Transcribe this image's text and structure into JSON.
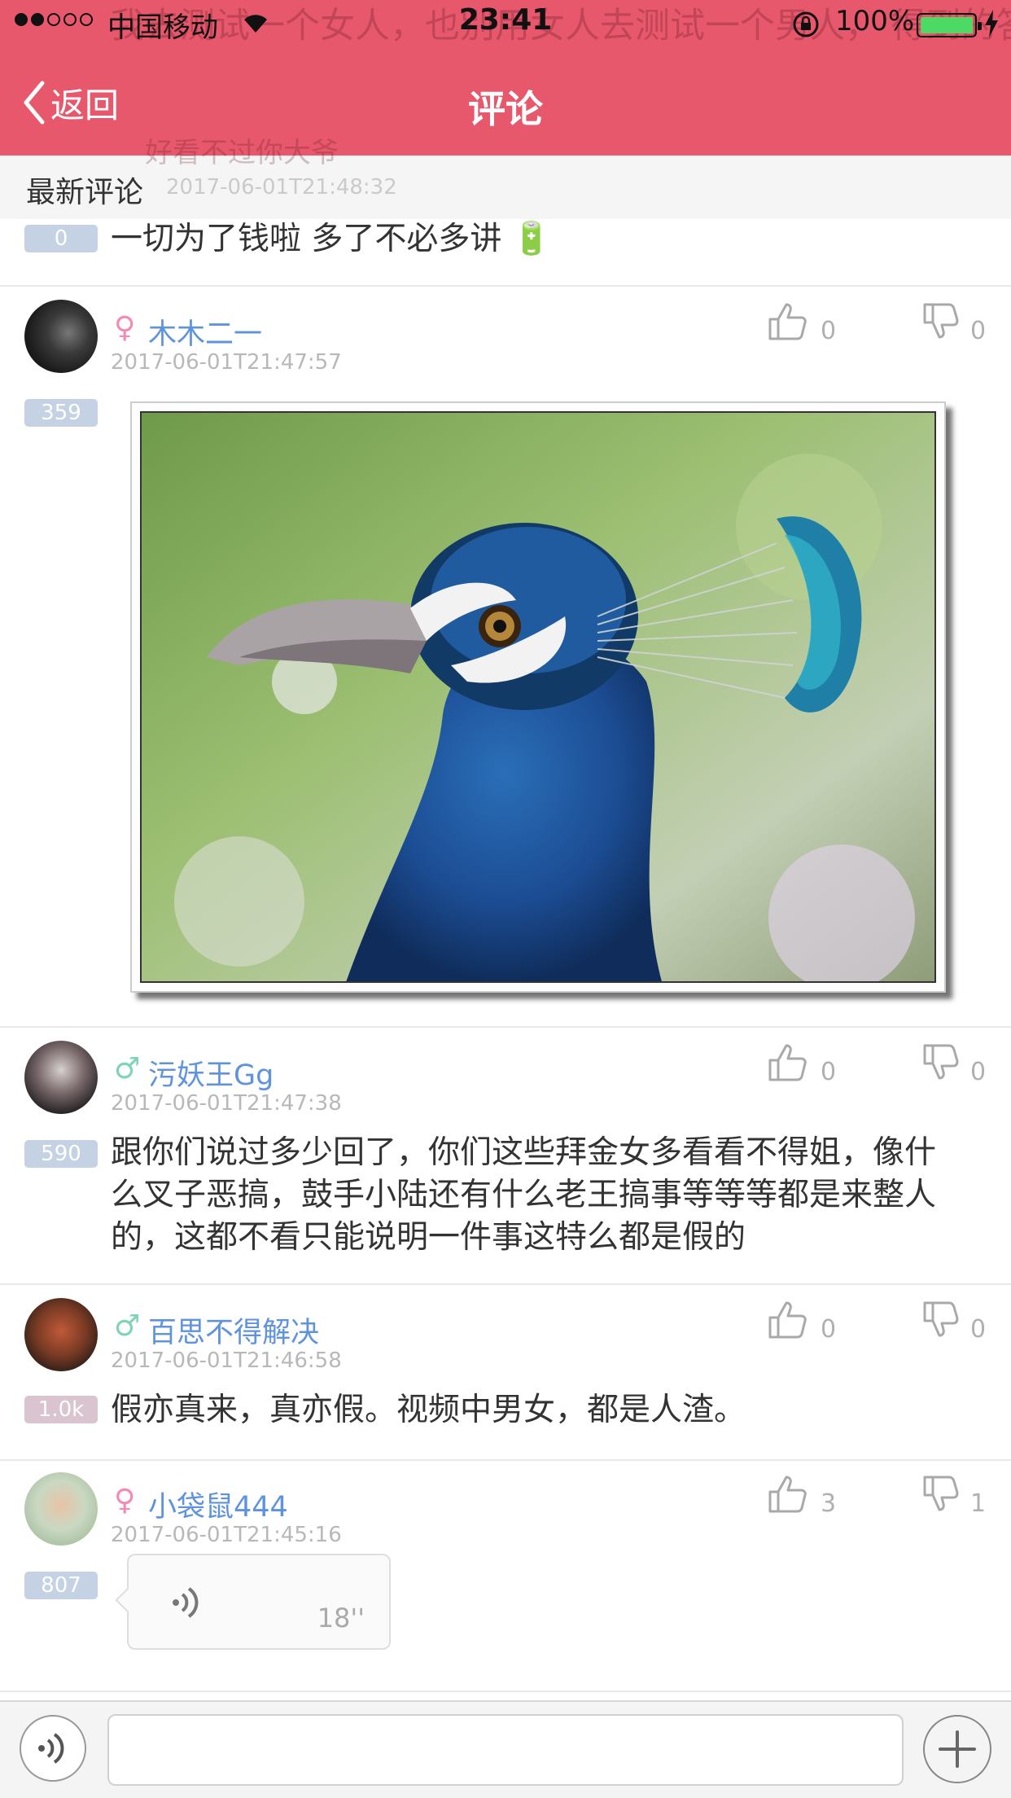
{
  "status_bar": {
    "carrier": "中国移动",
    "time": "23:41",
    "battery": "100%"
  },
  "nav": {
    "back_label": "返回",
    "title": "评论"
  },
  "behind_text": {
    "line": "我去测试一个女人，也别用女人去测试一个男人， 得到的答案都会一样 这是人类本性",
    "name": "好看不过你大爷",
    "date": "2017-06-01T21:48:32"
  },
  "section_title": "最新评论",
  "partial_comment": {
    "badge": "0",
    "text": "一切为了钱啦  多了不必多讲 🔋"
  },
  "comments": [
    {
      "gender": "♀",
      "username": "木木二一",
      "time": "2017-06-01T21:47:57",
      "badge": "359",
      "likes": "0",
      "dislikes": "0"
    },
    {
      "gender": "♂",
      "username": "污妖王Gg",
      "time": "2017-06-01T21:47:38",
      "badge": "590",
      "likes": "0",
      "dislikes": "0",
      "text": "跟你们说过多少回了，你们这些拜金女多看看不得姐，像什么叉子恶搞，鼓手小陆还有什么老王搞事等等等都是来整人的，这都不看只能说明一件事这特么都是假的"
    },
    {
      "gender": "♂",
      "username": "百思不得解决",
      "time": "2017-06-01T21:46:58",
      "badge": "1.0k",
      "likes": "0",
      "dislikes": "0",
      "text": "假亦真来，真亦假。视频中男女，都是人渣。"
    },
    {
      "gender": "♀",
      "username": "小袋鼠444",
      "time": "2017-06-01T21:45:16",
      "badge": "807",
      "likes": "3",
      "dislikes": "1",
      "voice_duration": "18''"
    }
  ],
  "input_bar": {
    "placeholder": ""
  },
  "colors": {
    "header": "#e8586c",
    "username": "#5f93dd",
    "female": "#f38ab6",
    "male": "#7ed3b8",
    "badge": "#c4d2e4"
  },
  "icons": [
    "wifi-icon",
    "orientation-lock-icon",
    "battery-icon",
    "charging-icon",
    "back-chevron-icon",
    "thumbs-up-icon",
    "thumbs-down-icon",
    "voice-wave-icon",
    "plus-icon"
  ]
}
